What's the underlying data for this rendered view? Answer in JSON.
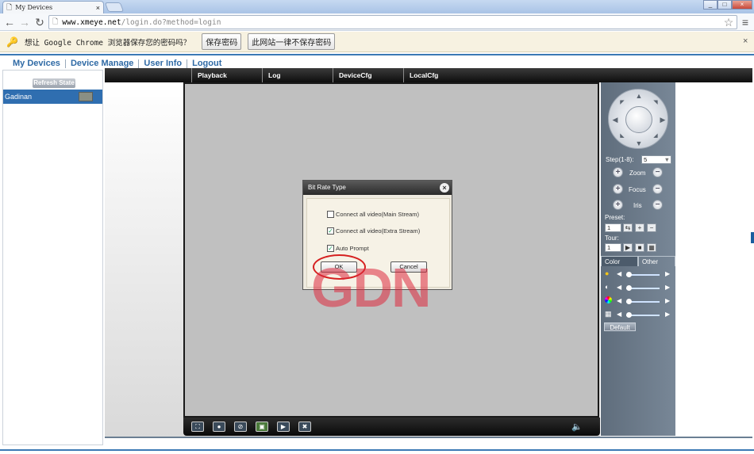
{
  "browser": {
    "tab_title": "My Devices",
    "tab_close": "×",
    "window_buttons": [
      "_",
      "□",
      "×"
    ],
    "url_host": "www.xmeye.net",
    "url_path": "/login.do?method=login",
    "infobar": {
      "message": "想让 Google Chrome 浏览器保存您的密码吗？",
      "save_button": "保存密码",
      "never_button": "此网站一律不保存密码",
      "close": "×"
    }
  },
  "app": {
    "nav": [
      "My Devices",
      "Device Manage",
      "User Info",
      "Logout"
    ],
    "refresh_button": "Refresh State",
    "device_name": "Gadinan",
    "tabs": [
      "Playback",
      "Log",
      "DeviceCfg",
      "LocalCfg"
    ]
  },
  "dialog": {
    "title": "Bit Rate Type",
    "options": [
      {
        "label": "Connect all video(Main Stream)",
        "checked": false
      },
      {
        "label": "Connect all video(Extra Stream)",
        "checked": true
      },
      {
        "label": "Auto Prompt",
        "checked": true
      }
    ],
    "ok": "OK",
    "cancel": "Cancel"
  },
  "watermark": "GDN",
  "ptz": {
    "step_label": "Step(1-8):",
    "step_value": "5",
    "zoom": "Zoom",
    "focus": "Focus",
    "iris": "Iris",
    "preset_label": "Preset:",
    "preset_value": "1",
    "tour_label": "Tour:",
    "tour_value": "1",
    "color_tab": "Color",
    "other_tab": "Other",
    "default_button": "Default"
  }
}
